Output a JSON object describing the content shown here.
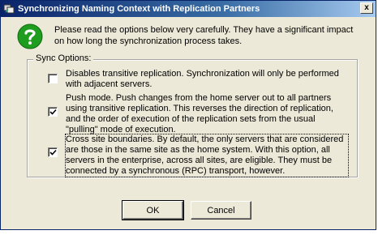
{
  "window": {
    "title": "Synchronizing Naming Context with Replication Partners",
    "close_label": "x"
  },
  "intro": "Please read the options below very carefully.  They have a significant impact on how long the synchronization process takes.",
  "sync_options": {
    "label": "Sync Options:",
    "items": [
      {
        "text": "Disables transitive replication. Synchronization will only be performed with adjacent servers.",
        "checked": false
      },
      {
        "text": "Push mode. Push changes from the home server out to all partners using transitive replication.  This reverses the direction of replication, and the order of execution of the replication sets from the usual \"pulling\" mode of execution.",
        "checked": true
      },
      {
        "text": "Cross site boundaries.  By default, the only servers that are considered are those in the same site as the home system.  With this option, all servers in the enterprise, across all sites, are eligible.  They must be connected by a synchronous (RPC) transport, however.",
        "checked": true
      }
    ]
  },
  "buttons": {
    "ok": "OK",
    "cancel": "Cancel"
  },
  "icons": {
    "question": "question-icon",
    "app": "app-icon",
    "checkmark": "checkmark-icon"
  },
  "colors": {
    "titlebar_start": "#0a246a",
    "dialog_bg": "#ece9d8",
    "question_green": "#1f9d1f"
  }
}
